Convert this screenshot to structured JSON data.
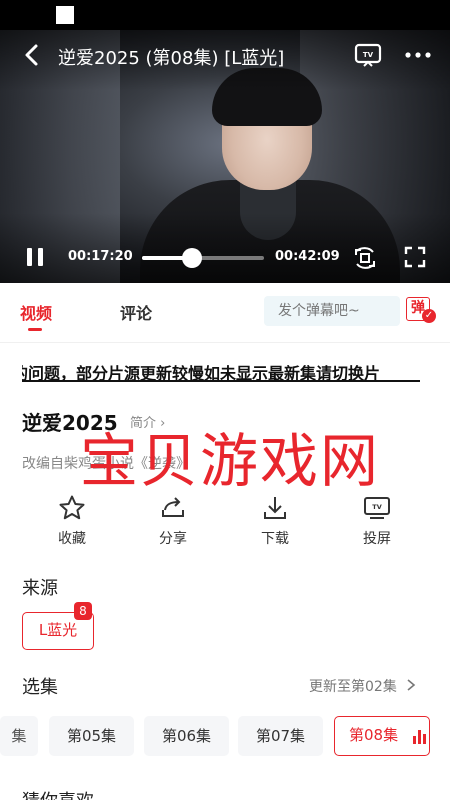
{
  "player": {
    "title": "逆爱2025 (第08集) [L蓝光]",
    "current_time": "00:17:20",
    "total_time": "00:42:09",
    "progress": 0.41
  },
  "tabs": {
    "video": "视频",
    "comment": "评论"
  },
  "danmaku": {
    "placeholder": "发个弹幕吧~",
    "button_label": "弹"
  },
  "notice": "的问题，部分片源更新较慢如未显示最新集请切换片",
  "show": {
    "title": "逆爱2025",
    "intro_link": "简介",
    "description": "改编自柴鸡蛋小说《逆袭》"
  },
  "watermark": "宝贝游戏网",
  "actions": {
    "favorite": "收藏",
    "share": "分享",
    "download": "下载",
    "cast": "投屏"
  },
  "source": {
    "section_title": "来源",
    "selected": "L蓝光",
    "badge": "8"
  },
  "episodes": {
    "section_title": "选集",
    "update_text": "更新至第02集",
    "partial": "集",
    "items": [
      "第05集",
      "第06集",
      "第07集",
      "第08集"
    ]
  },
  "guess": {
    "section_title": "猜你喜欢"
  },
  "colors": {
    "accent": "#e8262d"
  }
}
